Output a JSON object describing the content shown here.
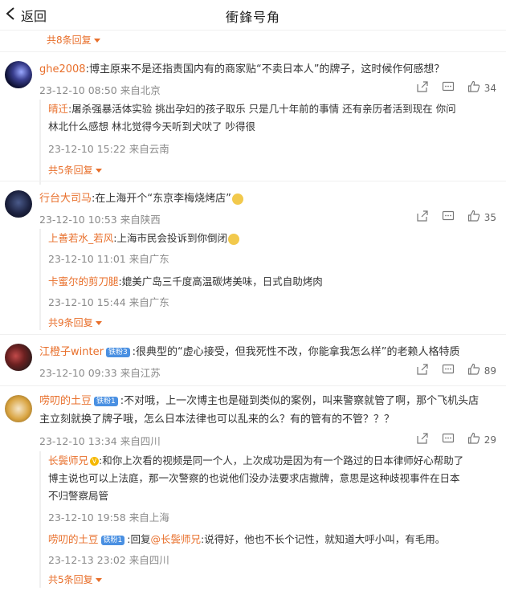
{
  "header": {
    "back_label": "返回",
    "title": "衝鋒号角"
  },
  "top_more": "共8条回复",
  "comments": [
    {
      "user": "ghe2008",
      "text": ":博主原来不是还指责国内有的商家贴“不卖日本人”的牌子，这时候作何感想？",
      "time": "23-12-10 08:50",
      "location": "来自北京",
      "likes": "34",
      "replies": [
        {
          "user": "晴迁",
          "text_line1": ":屠杀强暴活体实验  挑出孕妇的孩子取乐  只是几十年前的事情  还有亲历者活到现在  你问",
          "text_line2": "林北什么感想  林北觉得今天听到犬吠了  吵得很",
          "time": "23-12-10 15:22",
          "location": "来自云南"
        }
      ],
      "more": "共5条回复"
    },
    {
      "user": "行台大司马",
      "text": ":在上海开个“东京李梅烧烤店”",
      "time": "23-12-10 10:53",
      "location": "来自陕西",
      "likes": "35",
      "replies": [
        {
          "user": "上善若水_若风",
          "text": ":上海市民会投诉到你倒闭",
          "time": "23-12-10 11:01",
          "location": "来自广东"
        },
        {
          "user": "卡蜜尔的剪刀腿",
          "text": ":媲美广岛三千度高温碳烤美味，日式自助烤肉",
          "time": "23-12-10 15:44",
          "location": "来自广东"
        }
      ],
      "more": "共9条回复"
    },
    {
      "user": "江橙子winter",
      "badge": "铁粉3",
      "text": ":很典型的“虚心接受，但我死性不改，你能拿我怎么样”的老赖人格特质",
      "time": "23-12-10 09:33",
      "location": "来自江苏",
      "likes": "89"
    },
    {
      "user": "唠叨的土豆",
      "badge": "铁粉1",
      "text_line1": ":不对哦，上一次博主也是碰到类似的案例，叫来警察就管了啊，那个飞机头店",
      "text_line2": "主立刻就换了牌子哦，怎么日本法律也可以乱来的么？有的管有的不管？？？",
      "time": "23-12-10 13:34",
      "location": "来自四川",
      "likes": "29",
      "replies": [
        {
          "user": "长鬓师兄",
          "text_line1": ":和你上次看的视频是同一个人，上次成功是因为有一个路过的日本律师好心帮助了",
          "text_line2": "博主说也可以上法庭，那一次警察的也说他们没办法要求店撤牌，意思是这种歧视事件在日本",
          "text_line3": "不归警察局管",
          "time": "23-12-10 19:58",
          "location": "来自上海"
        },
        {
          "user": "唠叨的土豆",
          "badge": "铁粉1",
          "reply_prefix": ":回复",
          "reply_to": "@长鬓师兄",
          "text": ":说得好，他也不长个记性，就知道大呼小叫，有毛用。",
          "time": "23-12-13 23:02",
          "location": "来自四川"
        }
      ],
      "more": "共5条回复"
    }
  ],
  "colors": {
    "accent": "#e86f2b",
    "meta": "#8a8a8a",
    "badge": "#4a90e2",
    "divider": "#f0f0f0"
  }
}
